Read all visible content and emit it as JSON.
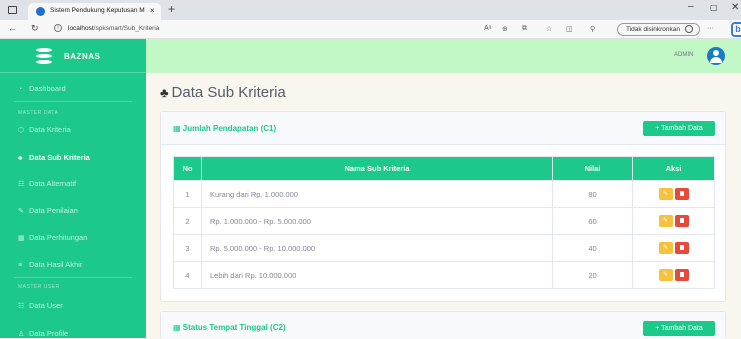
{
  "browser": {
    "tab_title": "Sistem Pendukung Keputusan M",
    "tab_close": "×",
    "new_tab": "+",
    "url_host": "localhost",
    "url_path": "/spksmart/Sub_Kriteria",
    "sync_label": "Tidak disinkronkan",
    "more": "···",
    "window": {
      "minimize": "–",
      "maximize": "▢",
      "close": "✕"
    },
    "nav": {
      "back": "←",
      "refresh": "↻"
    }
  },
  "sidebar": {
    "brand": "BAZNAS",
    "dashboard": "Dashboard",
    "heading_master_data": "MASTER DATA",
    "items": [
      {
        "label": "Data Kriteria",
        "icon": "cube-icon"
      },
      {
        "label": "Data Sub Kriteria",
        "icon": "cubes-icon"
      },
      {
        "label": "Data Alternatif",
        "icon": "users-icon"
      },
      {
        "label": "Data Penilaian",
        "icon": "edit-icon"
      },
      {
        "label": "Data Perhitungan",
        "icon": "calculator-icon"
      },
      {
        "label": "Data Hasil Akhir",
        "icon": "chart-icon"
      }
    ],
    "heading_master_user": "MASTER USER",
    "user_items": [
      {
        "label": "Data User",
        "icon": "users-cog-icon"
      },
      {
        "label": "Data Profile",
        "icon": "user-icon"
      }
    ]
  },
  "topbar": {
    "user": "ADMIN"
  },
  "page": {
    "title": "Data Sub Kriteria"
  },
  "cards": [
    {
      "title": "Jumlah Pendapatan (C1)",
      "add_label": "+ Tambah Data",
      "columns": [
        "No",
        "Nama Sub Kriteria",
        "Nilai",
        "Aksi"
      ],
      "rows": [
        {
          "no": "1",
          "nama": "Kurang dari Rp. 1.000.000",
          "nilai": "80"
        },
        {
          "no": "2",
          "nama": "Rp. 1.000.000 - Rp. 5.000.000",
          "nilai": "60"
        },
        {
          "no": "3",
          "nama": "Rp. 5.000.000 - Rp. 10.000.000",
          "nilai": "40"
        },
        {
          "no": "4",
          "nama": "Lebih dari Rp. 10.000.000",
          "nilai": "20"
        }
      ]
    },
    {
      "title": "Status Tempat Tinggal (C2)",
      "add_label": "+ Tambah Data"
    }
  ],
  "colors": {
    "primary": "#1cc88a",
    "topbar": "#c2f8c6",
    "edit": "#f6c23e",
    "delete": "#e74a3b"
  }
}
